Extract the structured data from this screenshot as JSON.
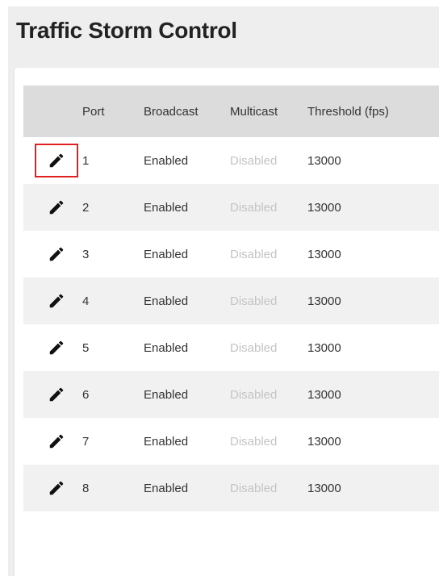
{
  "page": {
    "title": "Traffic Storm Control"
  },
  "table": {
    "headers": {
      "edit": "",
      "port": "Port",
      "broadcast": "Broadcast",
      "multicast": "Multicast",
      "threshold": "Threshold (fps)"
    },
    "rows": [
      {
        "port": "1",
        "broadcast": "Enabled",
        "multicast": "Disabled",
        "threshold": "13000"
      },
      {
        "port": "2",
        "broadcast": "Enabled",
        "multicast": "Disabled",
        "threshold": "13000"
      },
      {
        "port": "3",
        "broadcast": "Enabled",
        "multicast": "Disabled",
        "threshold": "13000"
      },
      {
        "port": "4",
        "broadcast": "Enabled",
        "multicast": "Disabled",
        "threshold": "13000"
      },
      {
        "port": "5",
        "broadcast": "Enabled",
        "multicast": "Disabled",
        "threshold": "13000"
      },
      {
        "port": "6",
        "broadcast": "Enabled",
        "multicast": "Disabled",
        "threshold": "13000"
      },
      {
        "port": "7",
        "broadcast": "Enabled",
        "multicast": "Disabled",
        "threshold": "13000"
      },
      {
        "port": "8",
        "broadcast": "Enabled",
        "multicast": "Disabled",
        "threshold": "13000"
      }
    ],
    "edit_icon": "pencil-icon",
    "highlight_color": "#e02020"
  }
}
